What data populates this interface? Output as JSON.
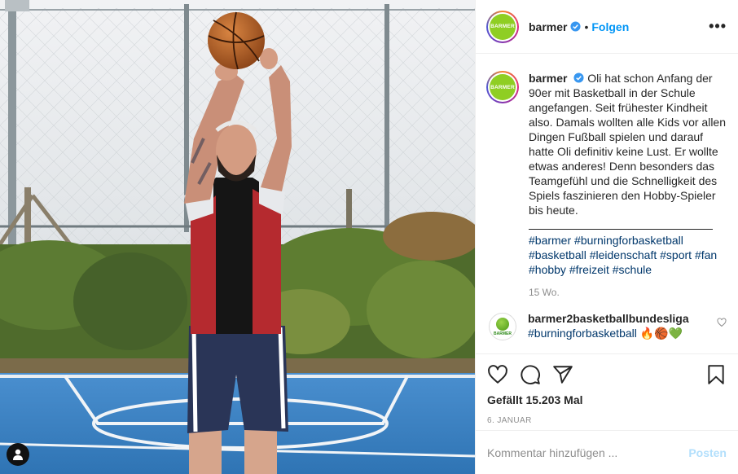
{
  "account": {
    "username": "barmer",
    "logo_text": "BARMER",
    "follow_label": "Folgen",
    "separator": "•",
    "more_label": "•••"
  },
  "caption": {
    "username": "barmer",
    "text": "Oli hat schon Anfang der 90er mit Basketball in der Schule angefangen. Seit frühester Kindheit also. Damals wollten alle Kids vor allen Dingen Fußball spielen und darauf hatte Oli definitiv keine Lust. Er wollte etwas anderes! Denn besonders das Teamgefühl und die Schnelligkeit des Spiels faszinieren den Hobby-Spieler bis heute.",
    "hashtags": [
      "#barmer",
      "#burningforbasketball",
      "#basketball",
      "#leidenschaft",
      "#sport",
      "#fan",
      "#hobby",
      "#freizeit",
      "#schule"
    ],
    "time": "15 Wo."
  },
  "comment": {
    "avatar_text": "BARMER",
    "username": "barmer2basketballbundesliga",
    "hashtag": "#burningforbasketball",
    "emoji": "🔥🏀💚"
  },
  "actions": {
    "icons": [
      "heart-icon",
      "comment-icon",
      "share-icon",
      "bookmark-icon"
    ],
    "likes": "Gefällt 15.203 Mal",
    "date": "6. JANUAR"
  },
  "composer": {
    "placeholder": "Kommentar hinzufügen ...",
    "post_label": "Posten"
  },
  "colors": {
    "brand_green": "#8fce23",
    "link_blue": "#0095f6",
    "hashtag": "#00376b",
    "court_blue": "#3f86c8"
  }
}
